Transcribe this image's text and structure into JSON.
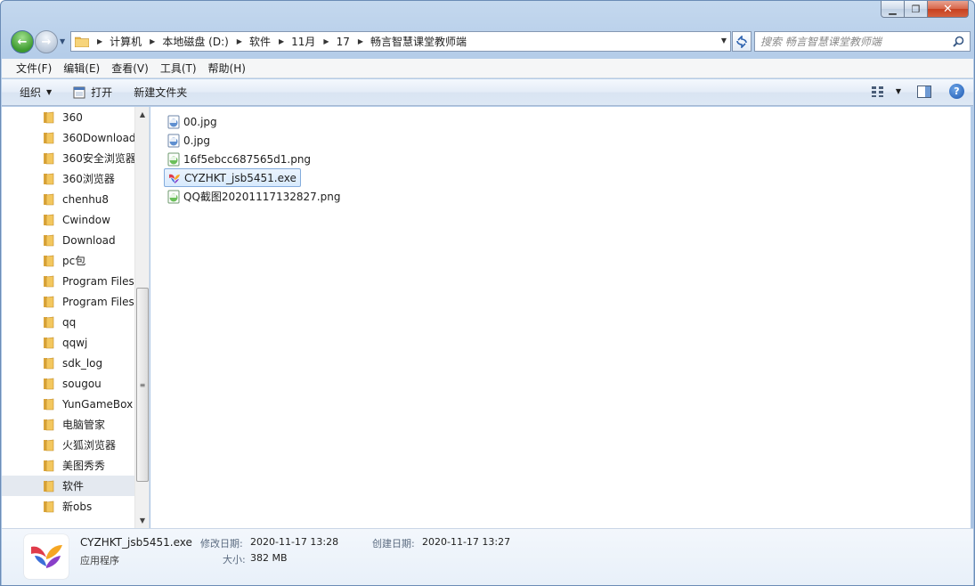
{
  "window": {
    "minimize_glyph": "▁",
    "maximize_glyph": "❐",
    "close_glyph": "✕"
  },
  "nav": {
    "back_glyph": "←",
    "forward_glyph": "→"
  },
  "breadcrumbs": [
    "计算机",
    "本地磁盘 (D:)",
    "软件",
    "11月",
    "17",
    "畅言智慧课堂教师端"
  ],
  "search": {
    "placeholder": "搜索 畅言智慧课堂教师端"
  },
  "menu": {
    "items": [
      "文件(F)",
      "编辑(E)",
      "查看(V)",
      "工具(T)",
      "帮助(H)"
    ]
  },
  "toolbar": {
    "organize_label": "组织",
    "open_label": "打开",
    "new_folder_label": "新建文件夹",
    "help_glyph": "?"
  },
  "sidebar": {
    "items": [
      {
        "label": "360"
      },
      {
        "label": "360Download"
      },
      {
        "label": "360安全浏览器"
      },
      {
        "label": "360浏览器"
      },
      {
        "label": "chenhu8"
      },
      {
        "label": "Cwindow"
      },
      {
        "label": "Download"
      },
      {
        "label": "pc包"
      },
      {
        "label": "Program Files"
      },
      {
        "label": "Program Files"
      },
      {
        "label": "qq"
      },
      {
        "label": "qqwj"
      },
      {
        "label": "sdk_log"
      },
      {
        "label": "sougou"
      },
      {
        "label": "YunGameBox"
      },
      {
        "label": "电脑管家"
      },
      {
        "label": "火狐浏览器"
      },
      {
        "label": "美图秀秀"
      },
      {
        "label": "软件",
        "selected": true
      },
      {
        "label": "新obs"
      }
    ]
  },
  "files": [
    {
      "name": "00.jpg",
      "icon": "jpg-file-icon"
    },
    {
      "name": "0.jpg",
      "icon": "jpg-file-icon"
    },
    {
      "name": "16f5ebcc687565d1.png",
      "icon": "png-file-icon"
    },
    {
      "name": "CYZHKT_jsb5451.exe",
      "icon": "app-exe-icon",
      "selected": true
    },
    {
      "name": "QQ截图20201117132827.png",
      "icon": "png-file-icon"
    }
  ],
  "details": {
    "name": "CYZHKT_jsb5451.exe",
    "type": "应用程序",
    "modified_label": "修改日期:",
    "modified_value": "2020-11-17 13:28",
    "created_label": "创建日期:",
    "created_value": "2020-11-17 13:27",
    "size_label": "大小:",
    "size_value": "382 MB"
  },
  "colors": {
    "accent": "#2e63b0",
    "selection": "#d8eafd",
    "folder": "#e8b64a"
  }
}
